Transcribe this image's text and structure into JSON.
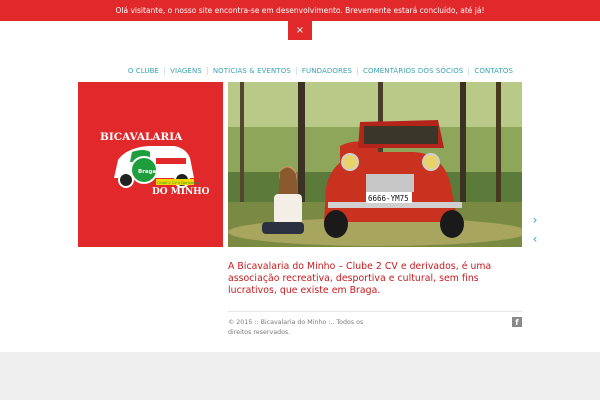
{
  "notice": {
    "text": "Olá visitante, o nosso site encontra-se em desenvolvimento. Brevemente estará concluído, até já!",
    "close_glyph": "×"
  },
  "nav": {
    "items": [
      {
        "label": "O CLUBE"
      },
      {
        "label": "VIAGENS"
      },
      {
        "label": "NOTÍCIAS & EVENTOS"
      },
      {
        "label": "FUNDADORES"
      },
      {
        "label": "COMENTÁRIOS DOS SÓCIOS"
      },
      {
        "label": "CONTATOS"
      }
    ]
  },
  "logo": {
    "line1": "BICAVALARIA",
    "line2": "DO MINHO",
    "badge": "Braga",
    "sub": "Clube 2 CV e Derivados"
  },
  "photo": {
    "plate": "6666-YM75"
  },
  "slider": {
    "next_glyph": "›",
    "prev_glyph": "‹"
  },
  "intro": {
    "text": "A Bicavalaria do Minho – Clube 2 CV e derivados, é uma associação recreativa, desportiva e cultural, sem fins lucrativos, que existe em Braga."
  },
  "footer": {
    "copyright": "© 2015 :: Bicavalaria do Minho :.. Todos os direitos reservados.",
    "facebook_glyph": "f"
  },
  "colors": {
    "brand_red": "#e1282b",
    "nav_teal": "#3aa3b5",
    "intro_red": "#c8191c"
  }
}
